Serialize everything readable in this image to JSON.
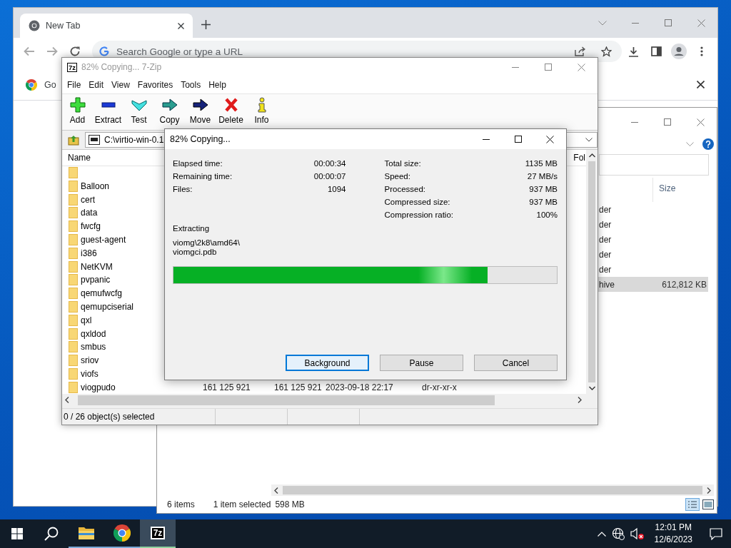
{
  "browser": {
    "tab": {
      "title": "New Tab",
      "selected": true
    },
    "omnibox": {
      "placeholder": "Search Google or type a URL"
    },
    "bookmark": "Go"
  },
  "explorer": {
    "column": "Size",
    "rows": [
      {
        "type": "der",
        "selected": false
      },
      {
        "type": "der",
        "selected": false
      },
      {
        "type": "der",
        "selected": false
      },
      {
        "type": "der",
        "selected": false
      },
      {
        "type": "der",
        "selected": false
      },
      {
        "type": "hive",
        "size": "612,812 KB",
        "selected": true
      }
    ],
    "status": {
      "count": "6 items",
      "selection": "1 item selected",
      "size": "598 MB"
    }
  },
  "archiver": {
    "icon": "7z",
    "title": "82% Copying... 7-Zip",
    "active": false,
    "menu": [
      "File",
      "Edit",
      "View",
      "Favorites",
      "Tools",
      "Help"
    ],
    "toolbar": [
      {
        "label": "Add",
        "kind": "add"
      },
      {
        "label": "Extract",
        "kind": "extract"
      },
      {
        "label": "Test",
        "kind": "test"
      },
      {
        "label": "Copy",
        "kind": "copy"
      },
      {
        "label": "Move",
        "kind": "move"
      },
      {
        "label": "Delete",
        "kind": "delete"
      },
      {
        "label": "Info",
        "kind": "info"
      }
    ],
    "path": "C:\\virtio-win-0.1",
    "columns": {
      "name": "Name",
      "column_6": "Fol"
    },
    "rows": [
      {
        "kind": "folder"
      },
      {
        "kind": "folder",
        "name": "Balloon"
      },
      {
        "kind": "folder",
        "name": "cert"
      },
      {
        "kind": "folder",
        "name": "data"
      },
      {
        "kind": "folder",
        "name": "fwcfg"
      },
      {
        "kind": "folder",
        "name": "guest-agent"
      },
      {
        "kind": "folder",
        "name": "i386"
      },
      {
        "kind": "folder",
        "name": "NetKVM"
      },
      {
        "kind": "folder",
        "name": "pvpanic"
      },
      {
        "kind": "folder",
        "name": "qemufwcfg"
      },
      {
        "kind": "folder",
        "name": "qemupciserial"
      },
      {
        "kind": "folder",
        "name": "qxl"
      },
      {
        "kind": "folder",
        "name": "qxldod"
      },
      {
        "kind": "folder",
        "name": "smbus"
      },
      {
        "kind": "folder",
        "name": "sriov"
      },
      {
        "kind": "folder",
        "name": "viofs"
      },
      {
        "kind": "folder",
        "name": "viogpudo",
        "cells": [
          "161 125 921",
          "161 125 921",
          "2023-09-18 22:17",
          "dr-xr-xr-x"
        ]
      }
    ],
    "status": "0 / 26 object(s) selected"
  },
  "dialog": {
    "title": "82% Copying...",
    "left_stats": [
      {
        "label": "Elapsed time:",
        "value": "00:00:34"
      },
      {
        "label": "Remaining time:",
        "value": "00:00:07"
      },
      {
        "label": "Files:",
        "value": "1094"
      }
    ],
    "right_stats": [
      {
        "label": "Total size:",
        "value": "1135 MB"
      },
      {
        "label": "Speed:",
        "value": "27 MB/s"
      },
      {
        "label": "Processed:",
        "value": "937 MB"
      },
      {
        "label": "Compressed size:",
        "value": "937 MB"
      },
      {
        "label": "Compression ratio:",
        "value": "100%"
      }
    ],
    "operation": "Extracting",
    "file_lines": [
      "viomg\\2k8\\amd64\\",
      "viomgci.pdb"
    ],
    "progress": {
      "level": 0.82
    },
    "buttons": [
      {
        "label": "Background",
        "focused": true
      },
      {
        "label": "Pause",
        "focused": false
      },
      {
        "label": "Cancel",
        "focused": false
      }
    ]
  },
  "taskbar": {
    "apps": [
      {
        "kind": "explorer",
        "running": true,
        "selected": false
      },
      {
        "kind": "browser",
        "running": true,
        "selected": false
      },
      {
        "kind": "archiver",
        "label": "7z",
        "running": true,
        "selected": true
      }
    ],
    "tray": {
      "muted": true
    },
    "clock": {
      "time": "12:01 PM",
      "date": "12/6/2023"
    }
  }
}
